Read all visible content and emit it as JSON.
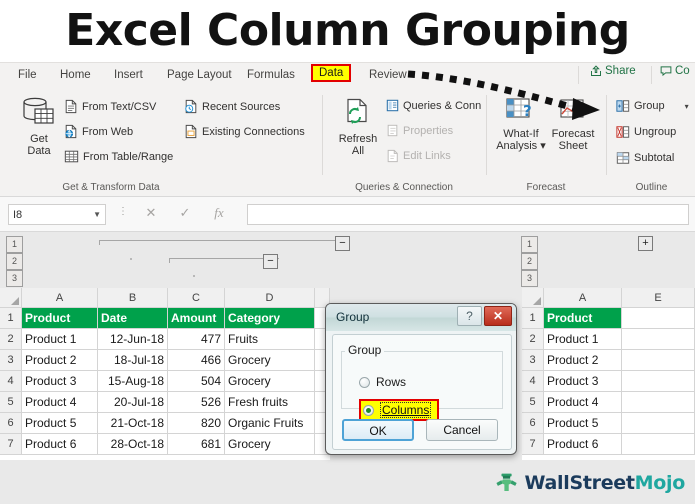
{
  "title": "Excel Column Grouping",
  "ribbon": {
    "tabs": [
      {
        "label": "File",
        "active": false
      },
      {
        "label": "Home",
        "active": false
      },
      {
        "label": "Insert",
        "active": false
      },
      {
        "label": "Page Layout",
        "active": false
      },
      {
        "label": "Formulas",
        "active": false
      },
      {
        "label": "Data",
        "active": true
      },
      {
        "label": "Review",
        "active": false
      }
    ],
    "share_label": "Share",
    "comments_label": "Co",
    "groups": [
      {
        "name": "Get & Transform Data",
        "big": {
          "label_line1": "Get",
          "label_line2": "Data",
          "icon": "get-data-icon"
        },
        "items": [
          {
            "label": "From Text/CSV",
            "icon": "text-csv-icon",
            "dim": false
          },
          {
            "label": "From Web",
            "icon": "web-icon",
            "dim": false
          },
          {
            "label": "From Table/Range",
            "icon": "table-range-icon",
            "dim": false
          },
          {
            "label": "Recent Sources",
            "icon": "recent-sources-icon",
            "dim": false
          },
          {
            "label": "Existing Connections",
            "icon": "existing-connections-icon",
            "dim": false
          }
        ]
      },
      {
        "name": "Queries & Connection",
        "big": {
          "label_line1": "Refresh",
          "label_line2": "All",
          "icon": "refresh-all-icon"
        },
        "items": [
          {
            "label": "Queries & Conn",
            "icon": "queries-conn-icon",
            "dim": false
          },
          {
            "label": "Properties",
            "icon": "properties-icon",
            "dim": true
          },
          {
            "label": "Edit Links",
            "icon": "edit-links-icon",
            "dim": true
          }
        ]
      },
      {
        "name": "Forecast",
        "items": [
          {
            "label_line1": "What-If",
            "label_line2": "Analysis",
            "icon": "what-if-analysis-icon"
          },
          {
            "label_line1": "Forecast",
            "label_line2": "Sheet",
            "icon": "forecast-sheet-icon"
          }
        ]
      },
      {
        "name": "Outline",
        "items": [
          {
            "label": "Group",
            "icon": "group-icon",
            "highlighted": true,
            "has_caret": true
          },
          {
            "label": "Ungroup",
            "icon": "ungroup-icon",
            "highlighted": false
          },
          {
            "label": "Subtotal",
            "icon": "subtotal-icon",
            "highlighted": false
          }
        ]
      }
    ]
  },
  "formula_bar": {
    "name_box_value": "I8",
    "cancel_icon": "cancel-icon",
    "confirm_icon": "confirm-icon",
    "function_icon": "fx-icon",
    "formula_value": ""
  },
  "outline_levels": [
    "1",
    "2",
    "3"
  ],
  "left_sheet": {
    "columns": [
      "A",
      "B",
      "C",
      "D"
    ],
    "rows": [
      "1",
      "2",
      "3",
      "4",
      "5",
      "6",
      "7"
    ],
    "header": [
      "Product",
      "Date",
      "Amount",
      "Category"
    ],
    "data": [
      [
        "Product 1",
        "12-Jun-18",
        "477",
        "Fruits"
      ],
      [
        "Product 2",
        "18-Jul-18",
        "466",
        "Grocery"
      ],
      [
        "Product 3",
        "15-Aug-18",
        "504",
        "Grocery"
      ],
      [
        "Product 4",
        "20-Jul-18",
        "526",
        "Fresh fruits"
      ],
      [
        "Product 5",
        "21-Oct-18",
        "820",
        "Organic Fruits"
      ],
      [
        "Product 6",
        "28-Oct-18",
        "681",
        "Grocery"
      ]
    ],
    "collapse_button_outer": "−",
    "collapse_button_inner": "−"
  },
  "right_sheet": {
    "columns": [
      "A",
      "E"
    ],
    "rows": [
      "1",
      "2",
      "3",
      "4",
      "5",
      "6",
      "7"
    ],
    "header": [
      "Product",
      ""
    ],
    "data": [
      [
        "Product 1",
        ""
      ],
      [
        "Product 2",
        ""
      ],
      [
        "Product 3",
        ""
      ],
      [
        "Product 4",
        ""
      ],
      [
        "Product 5",
        ""
      ],
      [
        "Product 6",
        ""
      ]
    ],
    "expand_button": "+"
  },
  "dialog": {
    "title": "Group",
    "help_label": "?",
    "close_label": "✕",
    "fieldset_legend": "Group",
    "option_rows": "Rows",
    "option_columns": "Columns",
    "selected_option": "Columns",
    "ok_label": "OK",
    "cancel_label": "Cancel"
  },
  "logo": {
    "text_part1": "WallStreet",
    "text_part2": "Mojo",
    "icon": "wallstreetmojo-logo-icon"
  },
  "colors": {
    "accent_green": "#00a14b",
    "excel_green": "#217346",
    "highlight_yellow": "#ffff00",
    "highlight_red": "#e30000",
    "ribbon_bg": "#f3f2f1"
  }
}
